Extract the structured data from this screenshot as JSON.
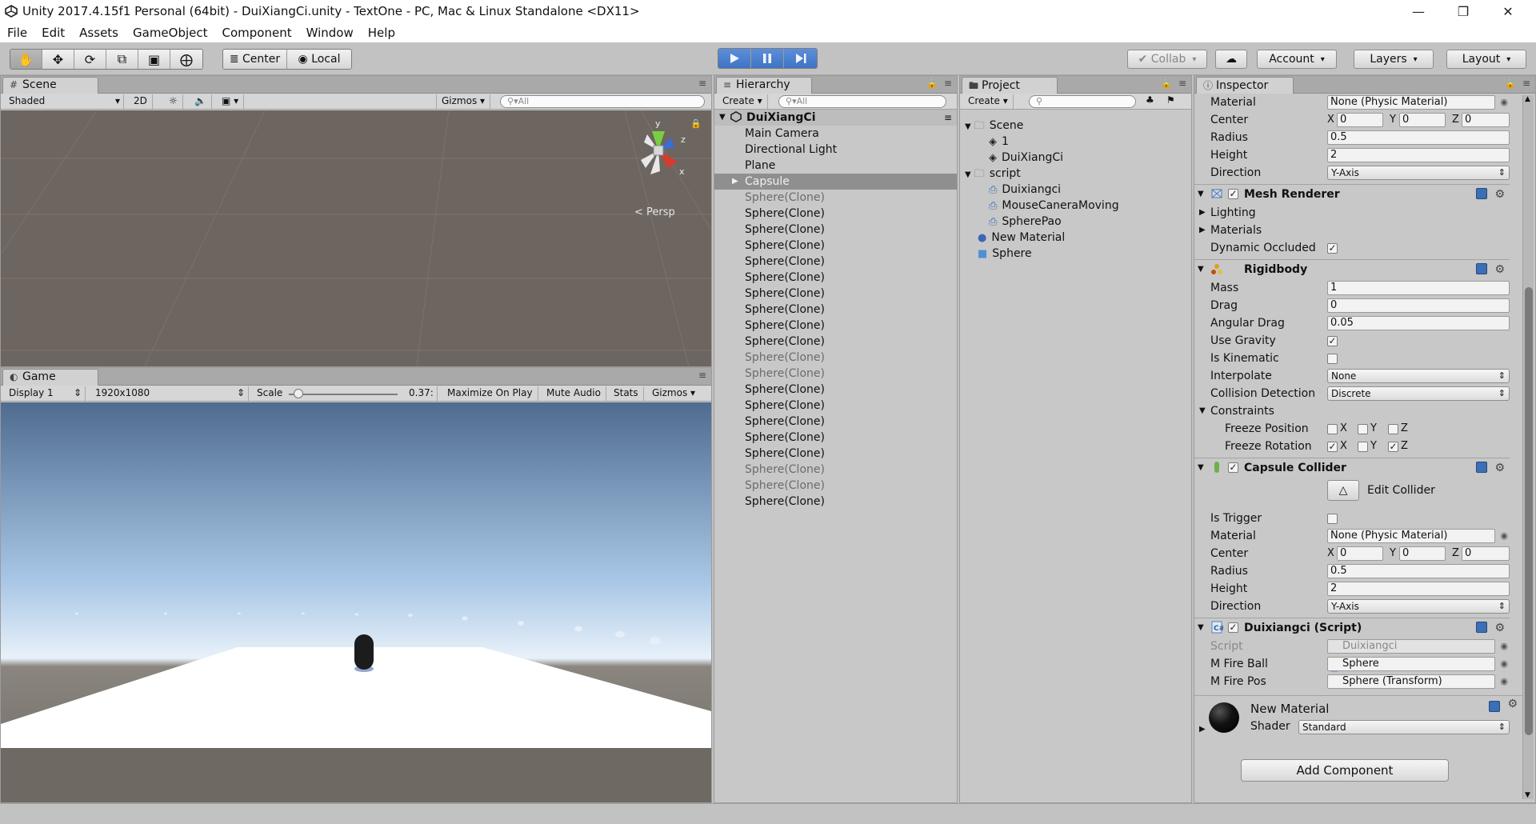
{
  "window": {
    "title": "Unity 2017.4.15f1 Personal (64bit) - DuiXiangCi.unity - TextOne - PC, Mac & Linux Standalone <DX11>",
    "minimize": "—",
    "restore": "❐",
    "close": "✕"
  },
  "menu": [
    "File",
    "Edit",
    "Assets",
    "GameObject",
    "Component",
    "Window",
    "Help"
  ],
  "toolbar": {
    "pivot": "Center",
    "space": "Local",
    "collab": "Collab",
    "account": "Account",
    "layers": "Layers",
    "layout": "Layout"
  },
  "scene": {
    "tab": "Scene",
    "shading": "Shaded",
    "mode2d": "2D",
    "gizmos": "Gizmos",
    "search_placeholder": "All",
    "persp": "< Persp",
    "axis_y": "y",
    "axis_z": "z",
    "axis_x": "x"
  },
  "game": {
    "tab": "Game",
    "display": "Display 1",
    "resolution": "1920x1080",
    "scale_label": "Scale",
    "scale_value": "0.37:",
    "scale_fraction": 0.05,
    "maximize": "Maximize On Play",
    "mute": "Mute Audio",
    "stats": "Stats",
    "gizmos": "Gizmos"
  },
  "hierarchy": {
    "tab": "Hierarchy",
    "create": "Create",
    "search_placeholder": "All",
    "scene_name": "DuiXiangCi",
    "items": [
      {
        "label": "Main Camera",
        "state": "normal"
      },
      {
        "label": "Directional Light",
        "state": "normal"
      },
      {
        "label": "Plane",
        "state": "normal"
      },
      {
        "label": "Capsule",
        "state": "selected"
      },
      {
        "label": "Sphere(Clone)",
        "state": "dim"
      },
      {
        "label": "Sphere(Clone)",
        "state": "normal"
      },
      {
        "label": "Sphere(Clone)",
        "state": "normal"
      },
      {
        "label": "Sphere(Clone)",
        "state": "normal"
      },
      {
        "label": "Sphere(Clone)",
        "state": "normal"
      },
      {
        "label": "Sphere(Clone)",
        "state": "normal"
      },
      {
        "label": "Sphere(Clone)",
        "state": "normal"
      },
      {
        "label": "Sphere(Clone)",
        "state": "normal"
      },
      {
        "label": "Sphere(Clone)",
        "state": "normal"
      },
      {
        "label": "Sphere(Clone)",
        "state": "normal"
      },
      {
        "label": "Sphere(Clone)",
        "state": "dim"
      },
      {
        "label": "Sphere(Clone)",
        "state": "dim"
      },
      {
        "label": "Sphere(Clone)",
        "state": "normal"
      },
      {
        "label": "Sphere(Clone)",
        "state": "normal"
      },
      {
        "label": "Sphere(Clone)",
        "state": "normal"
      },
      {
        "label": "Sphere(Clone)",
        "state": "normal"
      },
      {
        "label": "Sphere(Clone)",
        "state": "normal"
      },
      {
        "label": "Sphere(Clone)",
        "state": "dim"
      },
      {
        "label": "Sphere(Clone)",
        "state": "dim"
      },
      {
        "label": "Sphere(Clone)",
        "state": "normal"
      }
    ]
  },
  "project": {
    "tab": "Project",
    "create": "Create",
    "items": [
      {
        "label": "Scene",
        "kind": "folder",
        "depth": 0
      },
      {
        "label": "1",
        "kind": "unity",
        "depth": 1
      },
      {
        "label": "DuiXiangCi",
        "kind": "unity",
        "depth": 1
      },
      {
        "label": "script",
        "kind": "folder",
        "depth": 0
      },
      {
        "label": "Duixiangci",
        "kind": "script",
        "depth": 1
      },
      {
        "label": "MouseCaneraMoving",
        "kind": "script",
        "depth": 1
      },
      {
        "label": "SpherePao",
        "kind": "script",
        "depth": 1
      },
      {
        "label": "New Material",
        "kind": "material",
        "depth": 0
      },
      {
        "label": "Sphere",
        "kind": "prefab",
        "depth": 0
      }
    ]
  },
  "inspector": {
    "tab": "Inspector",
    "top_collider": {
      "material_label": "Material",
      "material_value": "None (Physic Material)",
      "center_label": "Center",
      "cx": "0",
      "cy": "0",
      "cz": "0",
      "radius_label": "Radius",
      "radius": "0.5",
      "height_label": "Height",
      "height": "2",
      "direction_label": "Direction",
      "direction": "Y-Axis"
    },
    "mesh_renderer": {
      "title": "Mesh Renderer",
      "lighting": "Lighting",
      "materials": "Materials",
      "dynamic_occluded": "Dynamic Occluded"
    },
    "rigidbody": {
      "title": "Rigidbody",
      "mass_label": "Mass",
      "mass": "1",
      "drag_label": "Drag",
      "drag": "0",
      "angular_label": "Angular Drag",
      "angular": "0.05",
      "gravity_label": "Use Gravity",
      "kinematic_label": "Is Kinematic",
      "interpolate_label": "Interpolate",
      "interpolate": "None",
      "collision_label": "Collision Detection",
      "collision": "Discrete",
      "constraints_label": "Constraints",
      "freeze_pos_label": "Freeze Position",
      "freeze_rot_label": "Freeze Rotation",
      "x": "X",
      "y": "Y",
      "z": "Z"
    },
    "capsule_collider": {
      "title": "Capsule Collider",
      "edit_collider": "Edit Collider",
      "trigger_label": "Is Trigger",
      "material_label": "Material",
      "material_value": "None (Physic Material)",
      "center_label": "Center",
      "cx": "0",
      "cy": "0",
      "cz": "0",
      "radius_label": "Radius",
      "radius": "0.5",
      "height_label": "Height",
      "height": "2",
      "direction_label": "Direction",
      "direction": "Y-Axis"
    },
    "script": {
      "title": "Duixiangci (Script)",
      "script_label": "Script",
      "script_value": "Duixiangci",
      "fireball_label": "M Fire Ball",
      "fireball_value": "Sphere",
      "firepos_label": "M Fire Pos",
      "firepos_value": "Sphere (Transform)"
    },
    "material": {
      "name": "New Material",
      "shader_label": "Shader",
      "shader": "Standard"
    },
    "add_component": "Add Component"
  }
}
